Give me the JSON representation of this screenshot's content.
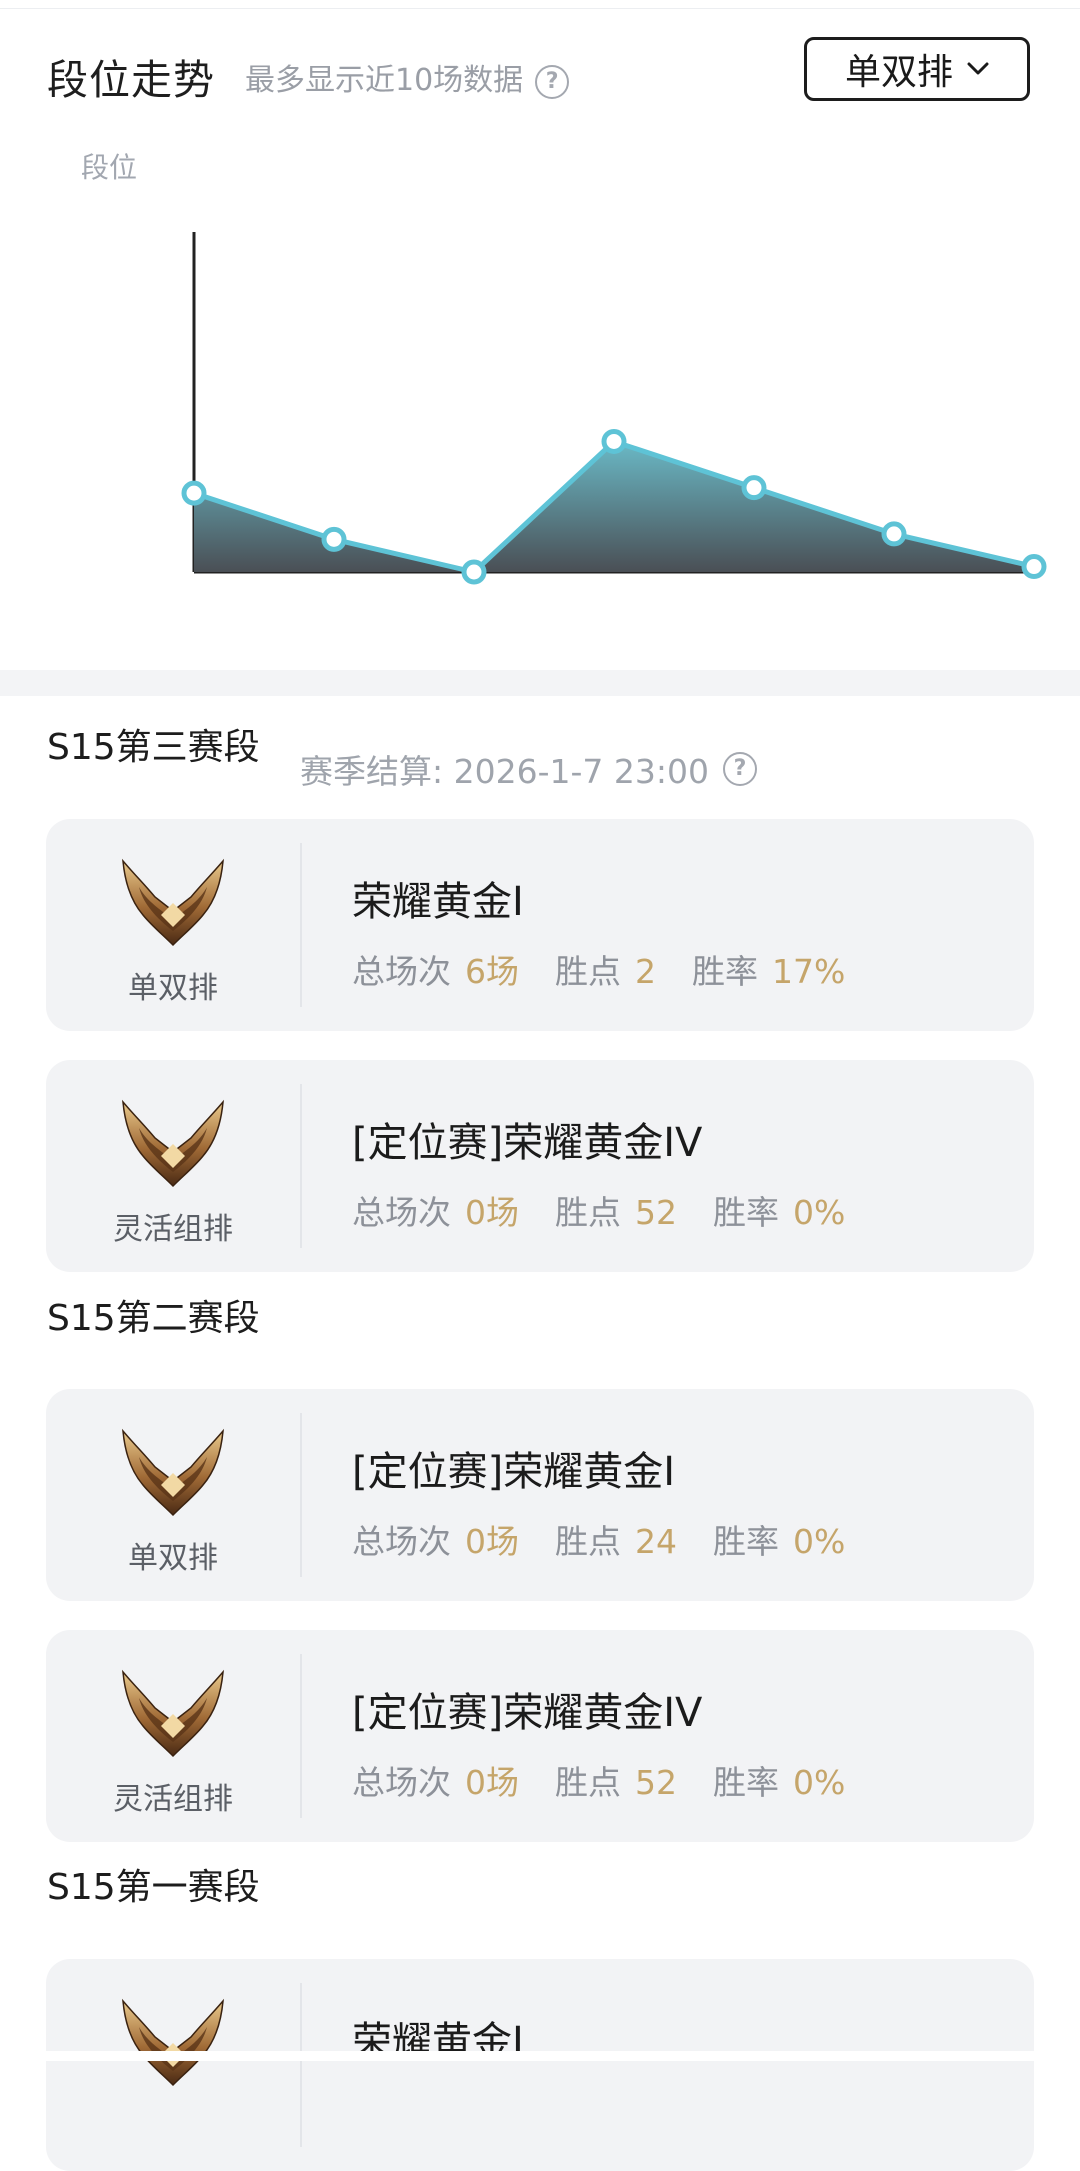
{
  "header": {
    "title": "段位走势",
    "subtitle": "最多显示近10场数据",
    "help": "?",
    "queue_select": "单双排"
  },
  "chart_data": {
    "type": "area",
    "ylabel": "段位",
    "title": "",
    "xlabel": "",
    "x": [
      1,
      2,
      3,
      4,
      5,
      6,
      7
    ],
    "values": [
      0.29,
      0.12,
      0.0,
      0.48,
      0.31,
      0.14,
      0.02
    ],
    "ylim": [
      0,
      1.25
    ],
    "grid": false,
    "colors": {
      "line": "#5ec3d6",
      "fill_top": "#6ab9c6",
      "fill_bottom": "#4a4f55"
    }
  },
  "seasons": [
    {
      "title": "S15第三赛段",
      "settle": "赛季结算: 2026-1-7 23:00",
      "cards": [
        {
          "queue": "单双排",
          "rank": "荣耀黄金I",
          "games_label": "总场次",
          "games": "6场",
          "points_label": "胜点",
          "points": "2",
          "winrate_label": "胜率",
          "winrate": "17%"
        },
        {
          "queue": "灵活组排",
          "rank": "[定位赛]荣耀黄金IV",
          "games_label": "总场次",
          "games": "0场",
          "points_label": "胜点",
          "points": "52",
          "winrate_label": "胜率",
          "winrate": "0%"
        }
      ]
    },
    {
      "title": "S15第二赛段",
      "cards": [
        {
          "queue": "单双排",
          "rank": "[定位赛]荣耀黄金I",
          "games_label": "总场次",
          "games": "0场",
          "points_label": "胜点",
          "points": "24",
          "winrate_label": "胜率",
          "winrate": "0%"
        },
        {
          "queue": "灵活组排",
          "rank": "[定位赛]荣耀黄金IV",
          "games_label": "总场次",
          "games": "0场",
          "points_label": "胜点",
          "points": "52",
          "winrate_label": "胜率",
          "winrate": "0%"
        }
      ]
    },
    {
      "title": "S15第一赛段",
      "cards": [
        {
          "rank": "荣耀黄金I"
        }
      ]
    }
  ],
  "icons": {
    "emblem": "gold-rank-emblem-icon",
    "help": "question-circle-icon",
    "chevron": "chevron-down-icon"
  }
}
